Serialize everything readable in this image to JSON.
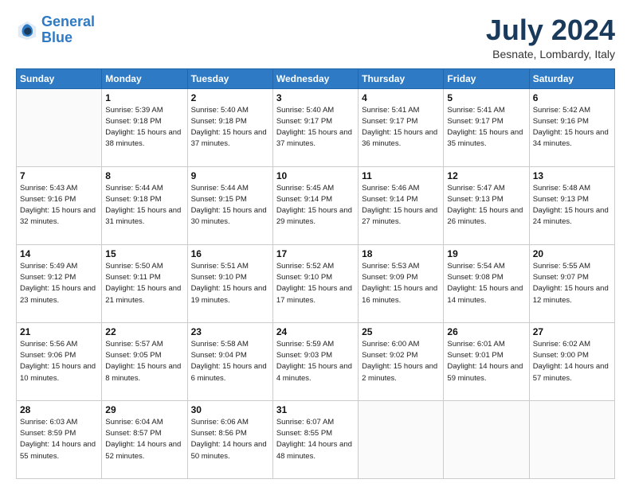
{
  "header": {
    "logo_line1": "General",
    "logo_line2": "Blue",
    "title": "July 2024",
    "location": "Besnate, Lombardy, Italy"
  },
  "weekdays": [
    "Sunday",
    "Monday",
    "Tuesday",
    "Wednesday",
    "Thursday",
    "Friday",
    "Saturday"
  ],
  "weeks": [
    [
      {
        "day": "",
        "sunrise": "",
        "sunset": "",
        "daylight": ""
      },
      {
        "day": "1",
        "sunrise": "Sunrise: 5:39 AM",
        "sunset": "Sunset: 9:18 PM",
        "daylight": "Daylight: 15 hours and 38 minutes."
      },
      {
        "day": "2",
        "sunrise": "Sunrise: 5:40 AM",
        "sunset": "Sunset: 9:18 PM",
        "daylight": "Daylight: 15 hours and 37 minutes."
      },
      {
        "day": "3",
        "sunrise": "Sunrise: 5:40 AM",
        "sunset": "Sunset: 9:17 PM",
        "daylight": "Daylight: 15 hours and 37 minutes."
      },
      {
        "day": "4",
        "sunrise": "Sunrise: 5:41 AM",
        "sunset": "Sunset: 9:17 PM",
        "daylight": "Daylight: 15 hours and 36 minutes."
      },
      {
        "day": "5",
        "sunrise": "Sunrise: 5:41 AM",
        "sunset": "Sunset: 9:17 PM",
        "daylight": "Daylight: 15 hours and 35 minutes."
      },
      {
        "day": "6",
        "sunrise": "Sunrise: 5:42 AM",
        "sunset": "Sunset: 9:16 PM",
        "daylight": "Daylight: 15 hours and 34 minutes."
      }
    ],
    [
      {
        "day": "7",
        "sunrise": "Sunrise: 5:43 AM",
        "sunset": "Sunset: 9:16 PM",
        "daylight": "Daylight: 15 hours and 32 minutes."
      },
      {
        "day": "8",
        "sunrise": "Sunrise: 5:44 AM",
        "sunset": "Sunset: 9:18 PM",
        "daylight": "Daylight: 15 hours and 31 minutes."
      },
      {
        "day": "9",
        "sunrise": "Sunrise: 5:44 AM",
        "sunset": "Sunset: 9:15 PM",
        "daylight": "Daylight: 15 hours and 30 minutes."
      },
      {
        "day": "10",
        "sunrise": "Sunrise: 5:45 AM",
        "sunset": "Sunset: 9:14 PM",
        "daylight": "Daylight: 15 hours and 29 minutes."
      },
      {
        "day": "11",
        "sunrise": "Sunrise: 5:46 AM",
        "sunset": "Sunset: 9:14 PM",
        "daylight": "Daylight: 15 hours and 27 minutes."
      },
      {
        "day": "12",
        "sunrise": "Sunrise: 5:47 AM",
        "sunset": "Sunset: 9:13 PM",
        "daylight": "Daylight: 15 hours and 26 minutes."
      },
      {
        "day": "13",
        "sunrise": "Sunrise: 5:48 AM",
        "sunset": "Sunset: 9:13 PM",
        "daylight": "Daylight: 15 hours and 24 minutes."
      }
    ],
    [
      {
        "day": "14",
        "sunrise": "Sunrise: 5:49 AM",
        "sunset": "Sunset: 9:12 PM",
        "daylight": "Daylight: 15 hours and 23 minutes."
      },
      {
        "day": "15",
        "sunrise": "Sunrise: 5:50 AM",
        "sunset": "Sunset: 9:11 PM",
        "daylight": "Daylight: 15 hours and 21 minutes."
      },
      {
        "day": "16",
        "sunrise": "Sunrise: 5:51 AM",
        "sunset": "Sunset: 9:10 PM",
        "daylight": "Daylight: 15 hours and 19 minutes."
      },
      {
        "day": "17",
        "sunrise": "Sunrise: 5:52 AM",
        "sunset": "Sunset: 9:10 PM",
        "daylight": "Daylight: 15 hours and 17 minutes."
      },
      {
        "day": "18",
        "sunrise": "Sunrise: 5:53 AM",
        "sunset": "Sunset: 9:09 PM",
        "daylight": "Daylight: 15 hours and 16 minutes."
      },
      {
        "day": "19",
        "sunrise": "Sunrise: 5:54 AM",
        "sunset": "Sunset: 9:08 PM",
        "daylight": "Daylight: 15 hours and 14 minutes."
      },
      {
        "day": "20",
        "sunrise": "Sunrise: 5:55 AM",
        "sunset": "Sunset: 9:07 PM",
        "daylight": "Daylight: 15 hours and 12 minutes."
      }
    ],
    [
      {
        "day": "21",
        "sunrise": "Sunrise: 5:56 AM",
        "sunset": "Sunset: 9:06 PM",
        "daylight": "Daylight: 15 hours and 10 minutes."
      },
      {
        "day": "22",
        "sunrise": "Sunrise: 5:57 AM",
        "sunset": "Sunset: 9:05 PM",
        "daylight": "Daylight: 15 hours and 8 minutes."
      },
      {
        "day": "23",
        "sunrise": "Sunrise: 5:58 AM",
        "sunset": "Sunset: 9:04 PM",
        "daylight": "Daylight: 15 hours and 6 minutes."
      },
      {
        "day": "24",
        "sunrise": "Sunrise: 5:59 AM",
        "sunset": "Sunset: 9:03 PM",
        "daylight": "Daylight: 15 hours and 4 minutes."
      },
      {
        "day": "25",
        "sunrise": "Sunrise: 6:00 AM",
        "sunset": "Sunset: 9:02 PM",
        "daylight": "Daylight: 15 hours and 2 minutes."
      },
      {
        "day": "26",
        "sunrise": "Sunrise: 6:01 AM",
        "sunset": "Sunset: 9:01 PM",
        "daylight": "Daylight: 14 hours and 59 minutes."
      },
      {
        "day": "27",
        "sunrise": "Sunrise: 6:02 AM",
        "sunset": "Sunset: 9:00 PM",
        "daylight": "Daylight: 14 hours and 57 minutes."
      }
    ],
    [
      {
        "day": "28",
        "sunrise": "Sunrise: 6:03 AM",
        "sunset": "Sunset: 8:59 PM",
        "daylight": "Daylight: 14 hours and 55 minutes."
      },
      {
        "day": "29",
        "sunrise": "Sunrise: 6:04 AM",
        "sunset": "Sunset: 8:57 PM",
        "daylight": "Daylight: 14 hours and 52 minutes."
      },
      {
        "day": "30",
        "sunrise": "Sunrise: 6:06 AM",
        "sunset": "Sunset: 8:56 PM",
        "daylight": "Daylight: 14 hours and 50 minutes."
      },
      {
        "day": "31",
        "sunrise": "Sunrise: 6:07 AM",
        "sunset": "Sunset: 8:55 PM",
        "daylight": "Daylight: 14 hours and 48 minutes."
      },
      {
        "day": "",
        "sunrise": "",
        "sunset": "",
        "daylight": ""
      },
      {
        "day": "",
        "sunrise": "",
        "sunset": "",
        "daylight": ""
      },
      {
        "day": "",
        "sunrise": "",
        "sunset": "",
        "daylight": ""
      }
    ]
  ]
}
